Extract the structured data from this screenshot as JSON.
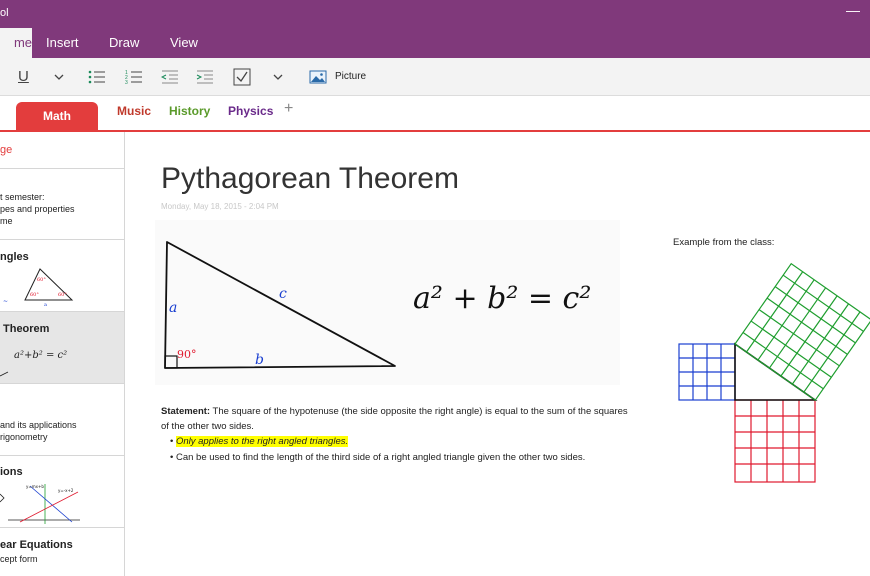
{
  "window": {
    "title": "ol",
    "minimize": "—"
  },
  "ribbon": {
    "tabs": [
      {
        "label": "me",
        "active": true
      },
      {
        "label": "Insert",
        "active": false
      },
      {
        "label": "Draw",
        "active": false
      },
      {
        "label": "View",
        "active": false
      }
    ]
  },
  "toolbar": {
    "underline": "U",
    "picture_label": "Picture",
    "icons": [
      "underline-icon",
      "chevron-down-icon",
      "bullet-list-icon",
      "numbered-list-icon",
      "outdent-icon",
      "indent-icon",
      "checkbox-icon",
      "chevron-down-icon",
      "picture-icon"
    ]
  },
  "sections": {
    "tabs": [
      {
        "label": "Math",
        "color": "#e33d3d",
        "active": true
      },
      {
        "label": "Music",
        "color": "#c0392b"
      },
      {
        "label": "History",
        "color": "#5a9a2a"
      },
      {
        "label": "Physics",
        "color": "#6a2a8a"
      }
    ],
    "add": "+"
  },
  "pages": {
    "add_page": "ge",
    "items": [
      {
        "title": "",
        "lines": [
          "t semester:",
          "pes and properties",
          "me"
        ]
      },
      {
        "title": "ngles",
        "lines": []
      },
      {
        "title": "Theorem",
        "lines": []
      },
      {
        "title": "",
        "lines": [
          "and its applications",
          "rigonometry"
        ]
      },
      {
        "title": "ions",
        "lines": []
      },
      {
        "title": "ear Equations",
        "lines": [
          "",
          "cept form"
        ]
      }
    ]
  },
  "note": {
    "title": "Pythagorean Theorem",
    "date": "Monday, May 18, 2015 - 2:04 PM",
    "ink": {
      "a": "a",
      "b": "b",
      "c": "c",
      "angle": "90°",
      "equation": "a² + b² = c²"
    },
    "statement_label": "Statement:",
    "statement_text": " The square of the hypotenuse (the side opposite the right angle) is equal to the sum of the squares of the other two sides.",
    "bullets": [
      "Only applies to the right angled triangles.",
      "Can be used to find the length of the third side of a right angled triangle given the other two sides."
    ],
    "example_label": "Example from the class:"
  },
  "colors": {
    "accent": "#80397b",
    "section": "#e33d3d",
    "ink_blue": "#1a3fd0",
    "ink_red": "#e0192e",
    "ink_green": "#1e9e2e"
  }
}
